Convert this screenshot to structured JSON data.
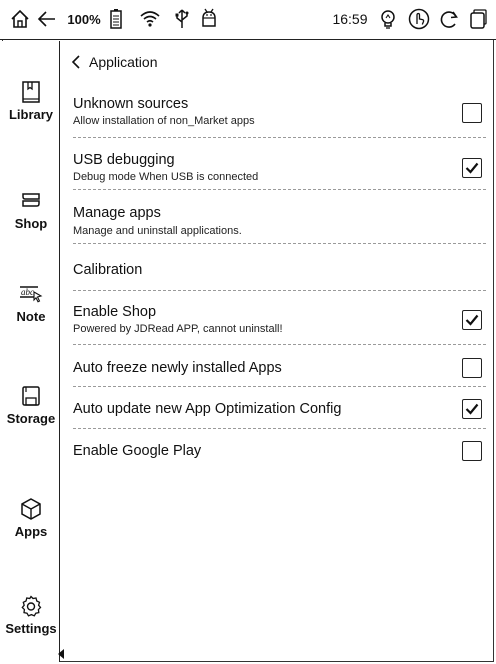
{
  "statusbar": {
    "battery_percent": "100%",
    "time": "16:59"
  },
  "sidebar": {
    "items": [
      {
        "label": "Library",
        "icon": "library-icon"
      },
      {
        "label": "Shop",
        "icon": "shop-icon"
      },
      {
        "label": "Note",
        "icon": "note-icon"
      },
      {
        "label": "Storage",
        "icon": "storage-icon"
      },
      {
        "label": "Apps",
        "icon": "apps-icon"
      },
      {
        "label": "Settings",
        "icon": "settings-icon"
      }
    ],
    "active": "Settings"
  },
  "header": {
    "title": "Application"
  },
  "settings": [
    {
      "title": "Unknown sources",
      "subtitle": "Allow installation of non_Market apps",
      "checked": false
    },
    {
      "title": "USB debugging",
      "subtitle": "Debug mode When USB is connected",
      "checked": true
    },
    {
      "title": "Manage apps",
      "subtitle": "Manage and uninstall applications."
    },
    {
      "title": "Calibration"
    },
    {
      "title": "Enable Shop",
      "subtitle": "Powered by JDRead APP, cannot uninstall!",
      "checked": true
    },
    {
      "title": "Auto freeze newly installed Apps",
      "checked": false
    },
    {
      "title": "Auto update new App Optimization Config",
      "checked": true
    },
    {
      "title": "Enable Google Play",
      "checked": false
    }
  ]
}
